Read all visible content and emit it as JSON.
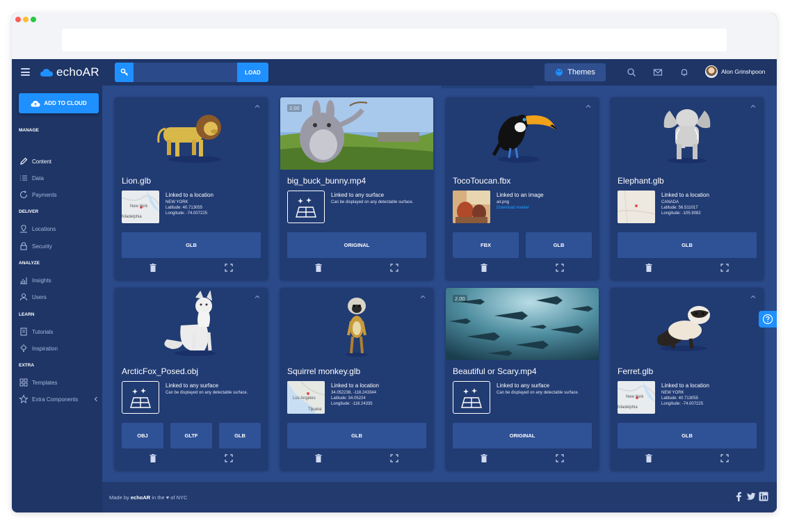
{
  "app": {
    "logo_text": "echoAR"
  },
  "topbar": {
    "search_placeholder": "",
    "load_label": "LOAD",
    "themes_label": "Themes",
    "user_name": "Alon Grinshpoon"
  },
  "sidebar": {
    "add_cloud_label": "ADD TO CLOUD",
    "sections": [
      {
        "label": "MANAGE",
        "items": [
          {
            "label": "Content",
            "icon": "pencil-icon"
          },
          {
            "label": "Data",
            "icon": "list-icon"
          },
          {
            "label": "Payments",
            "icon": "refresh-icon"
          }
        ]
      },
      {
        "label": "DELIVER",
        "items": [
          {
            "label": "Locations",
            "icon": "map-icon"
          },
          {
            "label": "Security",
            "icon": "lock-icon"
          }
        ]
      },
      {
        "label": "ANALYZE",
        "items": [
          {
            "label": "Insights",
            "icon": "chart-icon"
          },
          {
            "label": "Users",
            "icon": "user-icon"
          }
        ]
      },
      {
        "label": "LEARN",
        "items": [
          {
            "label": "Tutorials",
            "icon": "book-icon"
          },
          {
            "label": "Inspiration",
            "icon": "bulb-icon"
          }
        ]
      },
      {
        "label": "EXTRA",
        "items": [
          {
            "label": "Templates",
            "icon": "grid-icon"
          },
          {
            "label": "Extra Components",
            "icon": "star-icon"
          }
        ]
      }
    ]
  },
  "cards": [
    {
      "title": "Lion.glb",
      "badge": "",
      "info_title": "Linked to a location",
      "lines": [
        "NEW YORK",
        "Latitude: 40.713055",
        "Longitude: -74.007225"
      ],
      "map_labels": [
        "New York",
        "hiladelphia"
      ],
      "link": "",
      "formats": [
        "GLB"
      ]
    },
    {
      "title": "big_buck_bunny.mp4",
      "badge": "2.00",
      "info_title": "Linked to any surface",
      "lines": [
        "Can be displayed on any detectable surface."
      ],
      "map_labels": [],
      "link": "",
      "formats": [
        "ORIGINAL"
      ]
    },
    {
      "title": "TocoToucan.fbx",
      "badge": "",
      "info_title": "Linked to an image",
      "lines": [
        "air.png"
      ],
      "map_labels": [],
      "link": "Download marker",
      "formats": [
        "FBX",
        "GLB"
      ]
    },
    {
      "title": "Elephant.glb",
      "badge": "",
      "info_title": "Linked to a location",
      "lines": [
        "CANADA",
        "Latitude: 56.511017",
        "Longitude: -105.9082"
      ],
      "map_labels": [],
      "link": "",
      "formats": [
        "GLB"
      ]
    },
    {
      "title": "ArcticFox_Posed.obj",
      "badge": "",
      "info_title": "Linked to any surface",
      "lines": [
        "Can be displayed on any detectable surface."
      ],
      "map_labels": [],
      "link": "",
      "formats": [
        "OBJ",
        "GLTF",
        "GLB"
      ]
    },
    {
      "title": "Squirrel monkey.glb",
      "badge": "",
      "info_title": "Linked to a location",
      "lines": [
        "34.052238, -118.243344",
        "Latitude: 34.05224",
        "Longitude: -118.24335"
      ],
      "map_labels": [
        "Los Angeles",
        "Tijuana"
      ],
      "link": "",
      "formats": [
        "GLB"
      ]
    },
    {
      "title": "Beautiful or Scary.mp4",
      "badge": "2.00",
      "info_title": "Linked to any surface",
      "lines": [
        "Can be displayed on any detectable surface."
      ],
      "map_labels": [],
      "link": "",
      "formats": [
        "ORIGINAL"
      ]
    },
    {
      "title": "Ferret.glb",
      "badge": "",
      "info_title": "Linked to a location",
      "lines": [
        "NEW YORK",
        "Latitude: 40.713055",
        "Longitude: -74.007225"
      ],
      "map_labels": [
        "New York",
        "hiladelphia"
      ],
      "link": "",
      "formats": [
        "GLB"
      ]
    }
  ],
  "footer": {
    "made_by": "Made by",
    "brand": "echoAR",
    "rest": "in the ♥ of NYC"
  },
  "colors": {
    "accent": "#1e90ff",
    "background": "#223a6e",
    "card": "#213b73",
    "button": "#2f5196"
  }
}
